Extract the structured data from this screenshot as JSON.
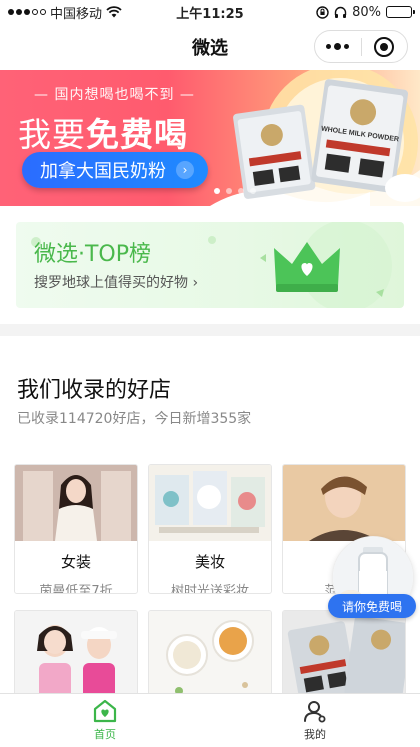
{
  "status_bar": {
    "carrier": "中国移动",
    "time": "上午11:25",
    "battery": "80%",
    "battery_level": 0.8
  },
  "nav": {
    "title": "微选"
  },
  "banner": {
    "tagline": "— 国内想喝也喝不到 —",
    "headline_light": "我要",
    "headline_bold": "免费喝",
    "cta_label": "加拿大国民奶粉",
    "cta_arrow": "›",
    "product_label": "WHOLE MILK POWDER",
    "pages": 4,
    "active_page": 0
  },
  "top_card": {
    "title": "微选·TOP榜",
    "subtitle": "搜罗地球上值得买的好物 ›"
  },
  "shops": {
    "title": "我们收录的好店",
    "subtitle": "已收录114720好店，今日新增355家",
    "tiles": [
      {
        "name": "女装",
        "desc": "茵曼低至7折"
      },
      {
        "name": "美妆",
        "desc": "树时光送彩妆"
      },
      {
        "name": "红",
        "desc": "范丞丞"
      },
      {
        "name": "",
        "desc": ""
      },
      {
        "name": "",
        "desc": ""
      },
      {
        "name": "",
        "desc": ""
      }
    ],
    "float_label": "请你免费喝"
  },
  "tabs": [
    {
      "label": "首页",
      "icon": "home-heart-icon",
      "active": true
    },
    {
      "label": "我的",
      "icon": "person-icon",
      "active": false
    }
  ],
  "colors": {
    "brand_green": "#3cb64a",
    "banner_pink": "#ff5b6e",
    "cta_blue": "#2b6cff"
  }
}
